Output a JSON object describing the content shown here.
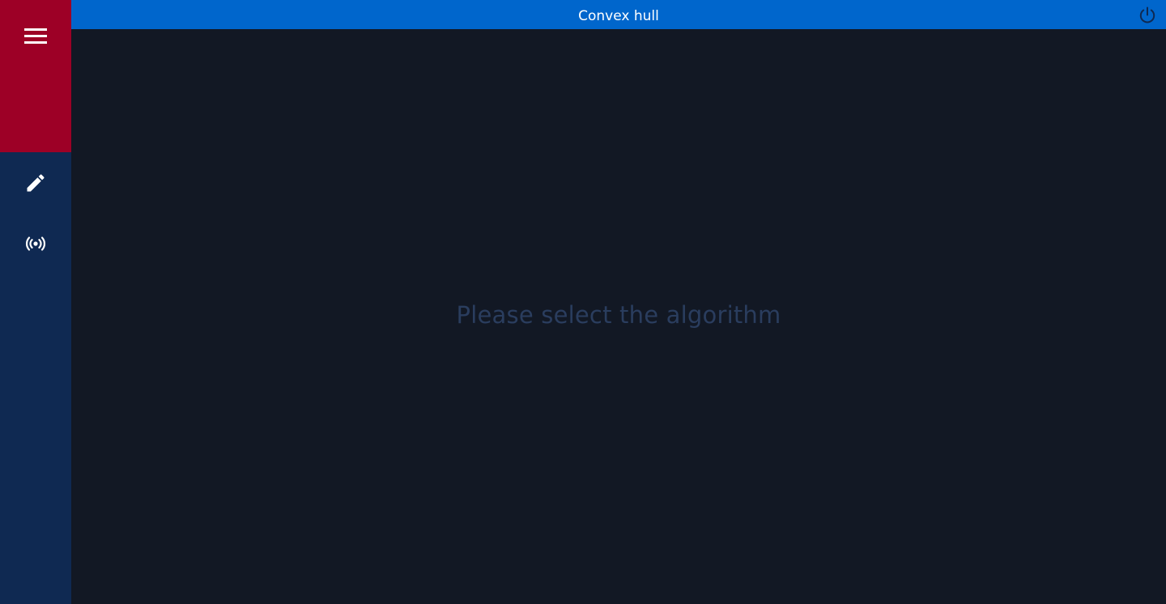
{
  "titlebar": {
    "title": "Convex hull",
    "power_icon": "power-icon"
  },
  "sidebar": {
    "menu_icon": "hamburger-menu-icon",
    "items": [
      {
        "icon": "pencil-icon"
      },
      {
        "icon": "broadcast-icon"
      }
    ]
  },
  "main": {
    "placeholder": "Please select the algorithm"
  },
  "colors": {
    "sidebar_top": "#9d0026",
    "sidebar": "#0f2952",
    "titlebar": "#0066cc",
    "canvas": "#121824",
    "placeholder_text": "#2a3d5e"
  }
}
